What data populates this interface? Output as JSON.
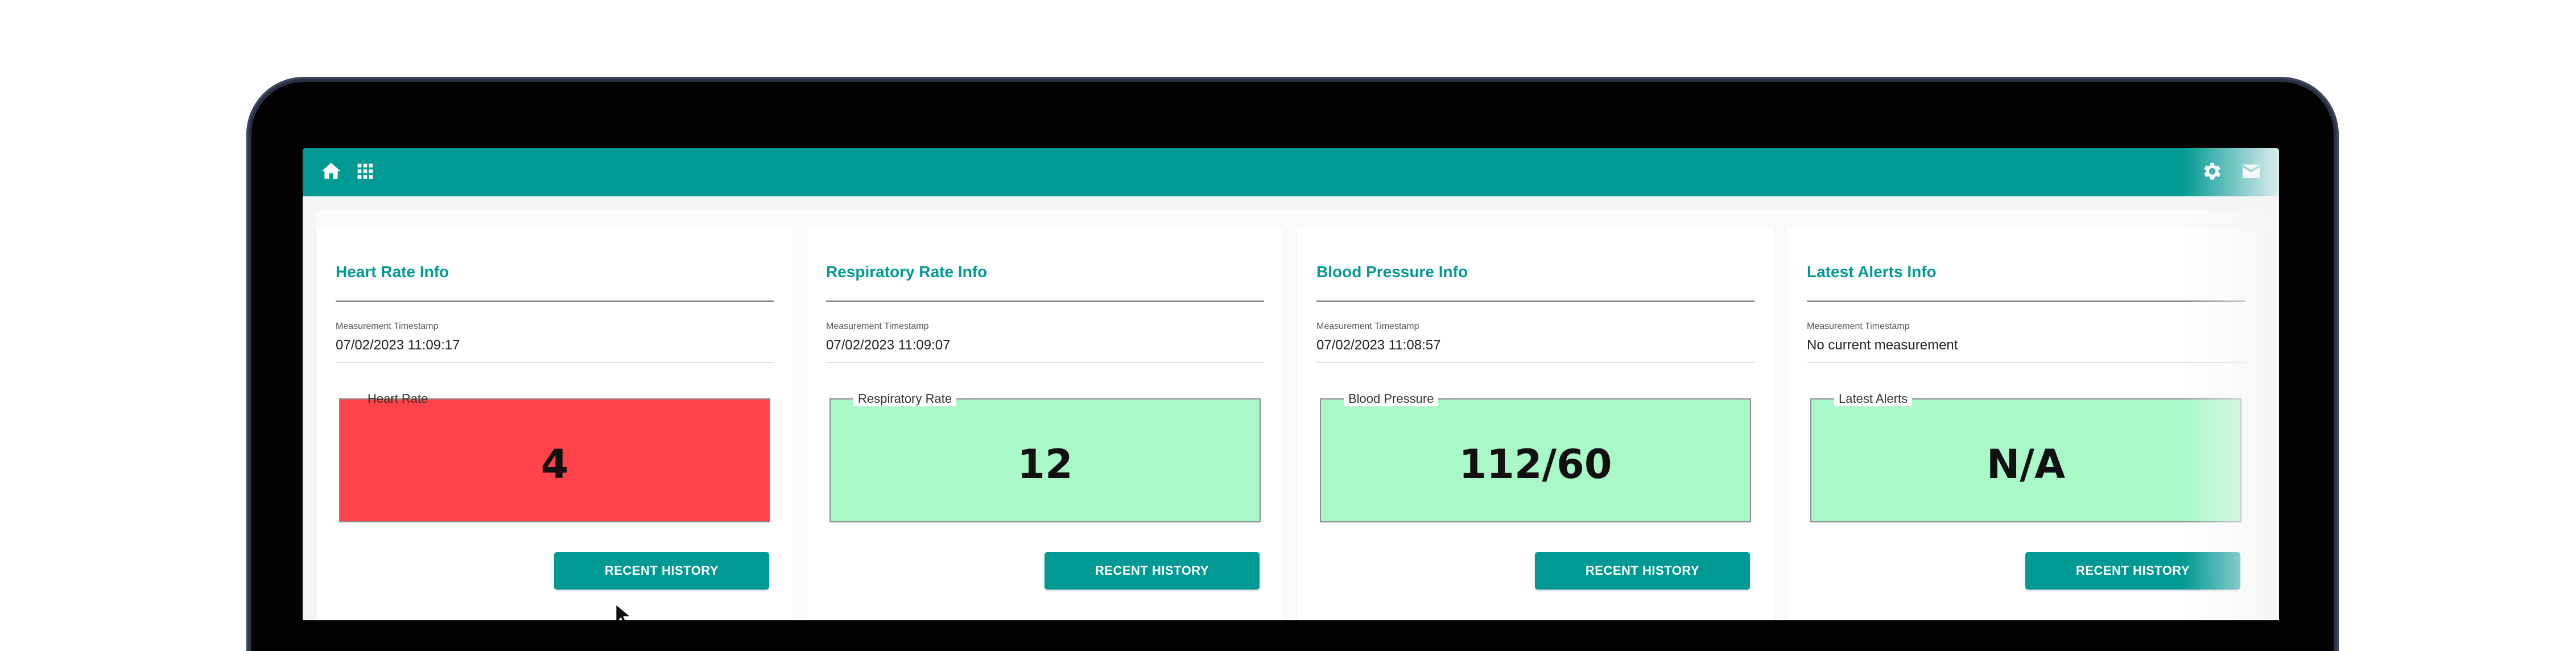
{
  "topbar": {
    "left_icons": [
      "home-icon",
      "apps-grid-icon"
    ],
    "right_icons": [
      "gear-icon",
      "mail-icon"
    ],
    "color": "#009993"
  },
  "cards": [
    {
      "title": "Heart Rate Info",
      "timestamp_label": "Measurement Timestamp",
      "timestamp_value": "07/02/2023 11:09:17",
      "metric_label": "Heart Rate",
      "metric_value": "4",
      "status_color": "#ff434b",
      "button_label": "RECENT HISTORY"
    },
    {
      "title": "Respiratory Rate Info",
      "timestamp_label": "Measurement Timestamp",
      "timestamp_value": "07/02/2023 11:09:07",
      "metric_label": "Respiratory Rate",
      "metric_value": "12",
      "status_color": "#a9f8c8",
      "button_label": "RECENT HISTORY"
    },
    {
      "title": "Blood Pressure Info",
      "timestamp_label": "Measurement Timestamp",
      "timestamp_value": "07/02/2023 11:08:57",
      "metric_label": "Blood Pressure",
      "metric_value": "112/60",
      "status_color": "#a9f8c8",
      "button_label": "RECENT HISTORY"
    },
    {
      "title": "Latest Alerts Info",
      "timestamp_label": "Measurement Timestamp",
      "timestamp_value": "No current measurement",
      "metric_label": "Latest Alerts",
      "metric_value": "N/A",
      "status_color": "#a9f8c8",
      "button_label": "RECENT HISTORY"
    }
  ]
}
